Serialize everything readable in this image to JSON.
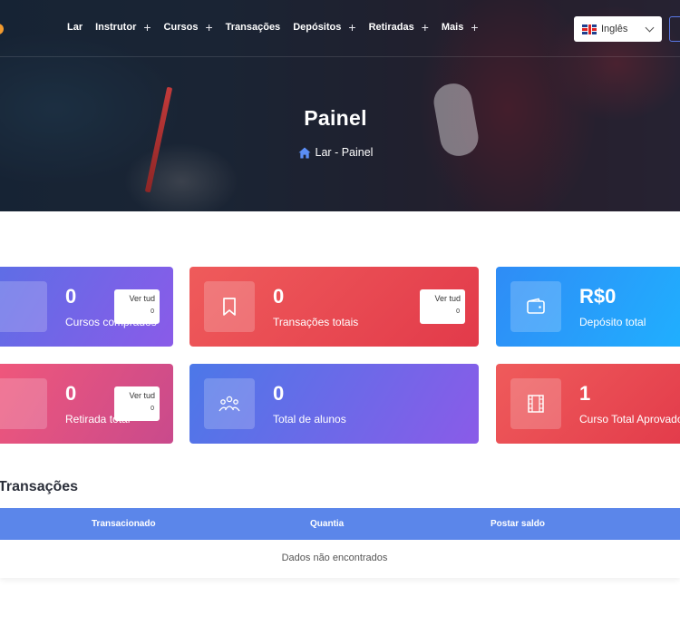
{
  "nav": {
    "items": [
      {
        "label": "Lar",
        "has_plus": false
      },
      {
        "label": "Instrutor",
        "has_plus": true
      },
      {
        "label": "Cursos",
        "has_plus": true
      },
      {
        "label": "Transações",
        "has_plus": false
      },
      {
        "label": "Depósitos",
        "has_plus": true
      },
      {
        "label": "Retiradas",
        "has_plus": true
      },
      {
        "label": "Mais",
        "has_plus": true
      }
    ],
    "plus_symbol": "+",
    "language": "Inglês"
  },
  "hero": {
    "title": "Painel",
    "breadcrumb": "Lar - Painel"
  },
  "cards": [
    {
      "value": "0",
      "label": "Cursos comprados",
      "view_label": "Ver tud",
      "view_count": "0",
      "icon": "courses-icon",
      "color": "#6f64e8"
    },
    {
      "value": "0",
      "label": "Transações totais",
      "view_label": "Ver tud",
      "view_count": "0",
      "icon": "bookmark-icon",
      "color": "#e84a4f"
    },
    {
      "value": "R$0",
      "label": "Depósito total",
      "icon": "wallet-icon",
      "color": "#279ef9"
    },
    {
      "value": "0",
      "label": "Retirada total",
      "view_label": "Ver tud",
      "view_count": "0",
      "icon": "withdraw-icon",
      "color": "#de5082"
    },
    {
      "value": "0",
      "label": "Total de alunos",
      "icon": "students-icon",
      "color": "#6a6ae8"
    },
    {
      "value": "1",
      "label": "Curso Total Aprovado",
      "icon": "film-icon",
      "color": "#e84a4f"
    }
  ],
  "transactions": {
    "title": "Transações",
    "columns": [
      "Transacionado",
      "Quantia",
      "Postar saldo"
    ],
    "empty_message": "Dados não encontrados"
  }
}
